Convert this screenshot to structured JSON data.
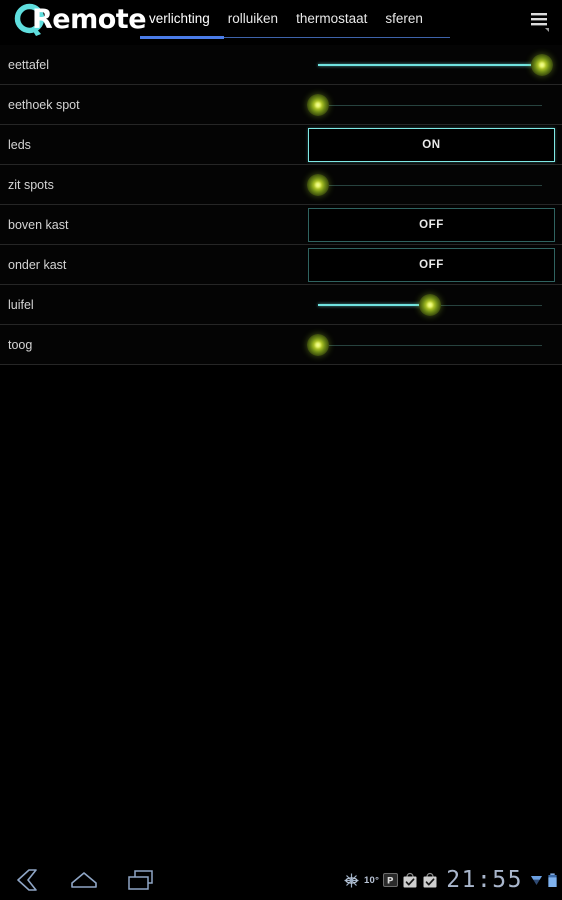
{
  "app": {
    "logo_letter": "Q",
    "logo_text": "Remote",
    "logo_color": "#5fdede",
    "accent_color": "#4a7ce8",
    "slider_fill_color": "#6fe3e0",
    "thumb_color": "#a8bf25",
    "on_border_color": "#7fe9e6",
    "off_border_color": "#2f6360"
  },
  "tabs": [
    {
      "label": "verlichting",
      "active": true
    },
    {
      "label": "rolluiken",
      "active": false
    },
    {
      "label": "thermostaat",
      "active": false
    },
    {
      "label": "sferen",
      "active": false
    }
  ],
  "menu": {
    "icon": "hamburger-menu-icon"
  },
  "rows": [
    {
      "label": "eettafel",
      "control": "slider",
      "value": 100
    },
    {
      "label": "eethoek spot",
      "control": "slider",
      "value": 0
    },
    {
      "label": "leds",
      "control": "toggle",
      "state": "ON"
    },
    {
      "label": "zit spots",
      "control": "slider",
      "value": 0
    },
    {
      "label": "boven kast",
      "control": "toggle",
      "state": "OFF"
    },
    {
      "label": "onder kast",
      "control": "toggle",
      "state": "OFF"
    },
    {
      "label": "luifel",
      "control": "slider",
      "value": 50
    },
    {
      "label": "toog",
      "control": "slider",
      "value": 0
    }
  ],
  "navbar": {
    "back": "back-icon",
    "home": "home-icon",
    "recents": "recent-apps-icon",
    "status": {
      "weather_icon": "weather-icon",
      "temperature": "10°",
      "parking_icon": "parking-badge-icon",
      "task_icon_1": "checked-bag-icon",
      "task_icon_2": "checked-bag-icon",
      "clock": "21:55",
      "signal_icon": "signal-icon",
      "battery_icon": "battery-icon"
    }
  }
}
